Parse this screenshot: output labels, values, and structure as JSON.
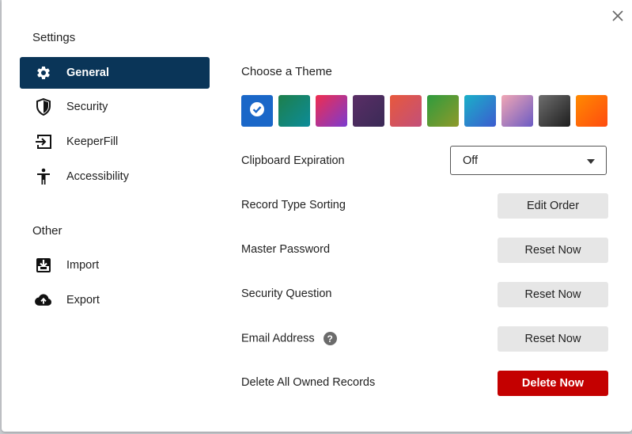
{
  "sidebar": {
    "settings_heading": "Settings",
    "items": [
      {
        "label": "General",
        "icon": "gear-icon"
      },
      {
        "label": "Security",
        "icon": "shield-icon"
      },
      {
        "label": "KeeperFill",
        "icon": "keeperfill-icon"
      },
      {
        "label": "Accessibility",
        "icon": "accessibility-icon"
      }
    ],
    "other_heading": "Other",
    "other_items": [
      {
        "label": "Import",
        "icon": "import-icon"
      },
      {
        "label": "Export",
        "icon": "cloud-upload-icon"
      }
    ]
  },
  "theme": {
    "title": "Choose a Theme",
    "selected_index": 0,
    "swatches": [
      {
        "name": "blue",
        "color": "#1a67c8"
      },
      {
        "name": "teal",
        "color": "linear-gradient(135deg,#1d7f4b,#0c8c9a)"
      },
      {
        "name": "pink-purple",
        "color": "linear-gradient(135deg,#ef2d4f,#7b3bd0)"
      },
      {
        "name": "plum",
        "color": "linear-gradient(135deg,#5a2e66,#3a2a56)"
      },
      {
        "name": "coral",
        "color": "linear-gradient(135deg,#e8583c,#c2507a)"
      },
      {
        "name": "green-olive",
        "color": "linear-gradient(135deg,#2e9b3e,#8f9a2a)"
      },
      {
        "name": "cyan-blue",
        "color": "linear-gradient(135deg,#1ab0c8,#3c5bd0)"
      },
      {
        "name": "pastel",
        "color": "linear-gradient(135deg,#f1a6b4,#6b5bc4)"
      },
      {
        "name": "graphite",
        "color": "linear-gradient(135deg,#6e6e6e,#1e1e1e)"
      },
      {
        "name": "orange",
        "color": "linear-gradient(135deg,#ff8a00,#ff4b10)"
      }
    ]
  },
  "settings": {
    "clipboard_label": "Clipboard Expiration",
    "clipboard_value": "Off",
    "record_sorting_label": "Record Type Sorting",
    "record_sorting_button": "Edit Order",
    "master_password_label": "Master Password",
    "master_password_button": "Reset Now",
    "security_question_label": "Security Question",
    "security_question_button": "Reset Now",
    "email_label": "Email Address",
    "email_help": "?",
    "email_button": "Reset Now",
    "delete_label": "Delete All Owned Records",
    "delete_button": "Delete Now"
  },
  "colors": {
    "active_nav": "#0a3558",
    "danger": "#c40000",
    "button_bg": "#e6e6e6"
  }
}
